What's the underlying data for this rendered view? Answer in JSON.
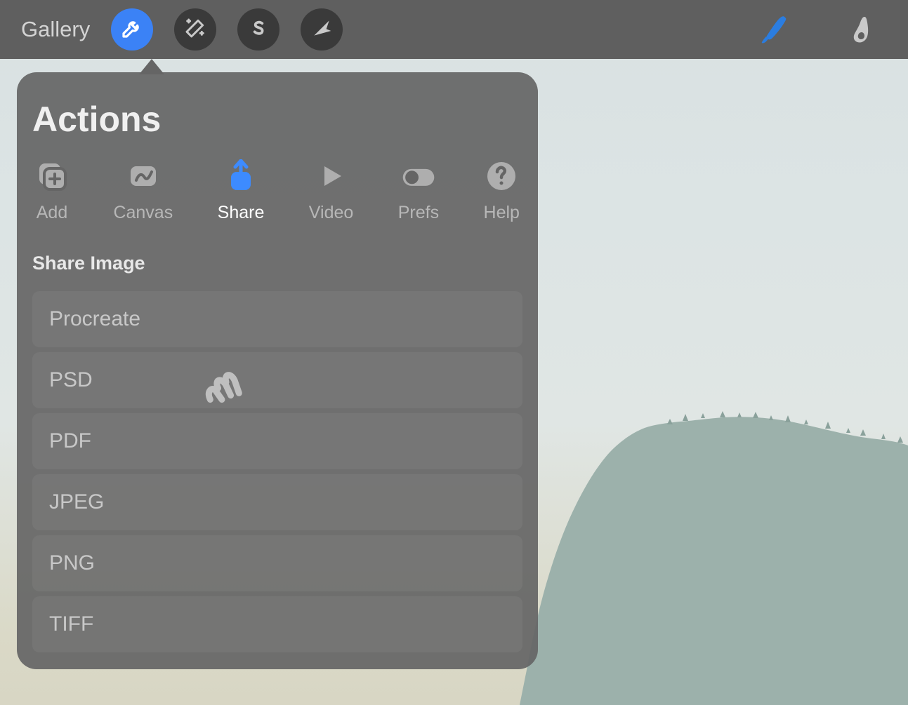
{
  "toolbar": {
    "gallery_label": "Gallery"
  },
  "popover": {
    "title": "Actions",
    "tabs": [
      {
        "id": "add",
        "label": "Add"
      },
      {
        "id": "canvas",
        "label": "Canvas"
      },
      {
        "id": "share",
        "label": "Share"
      },
      {
        "id": "video",
        "label": "Video"
      },
      {
        "id": "prefs",
        "label": "Prefs"
      },
      {
        "id": "help",
        "label": "Help"
      }
    ],
    "active_tab": "share",
    "section_header": "Share Image",
    "share_options": [
      {
        "label": "Procreate"
      },
      {
        "label": "PSD"
      },
      {
        "label": "PDF"
      },
      {
        "label": "JPEG"
      },
      {
        "label": "PNG"
      },
      {
        "label": "TIFF"
      }
    ]
  },
  "colors": {
    "accent_blue": "#3b82f6",
    "toolbar_bg": "#5f5f5f",
    "popover_bg": "#656565"
  }
}
